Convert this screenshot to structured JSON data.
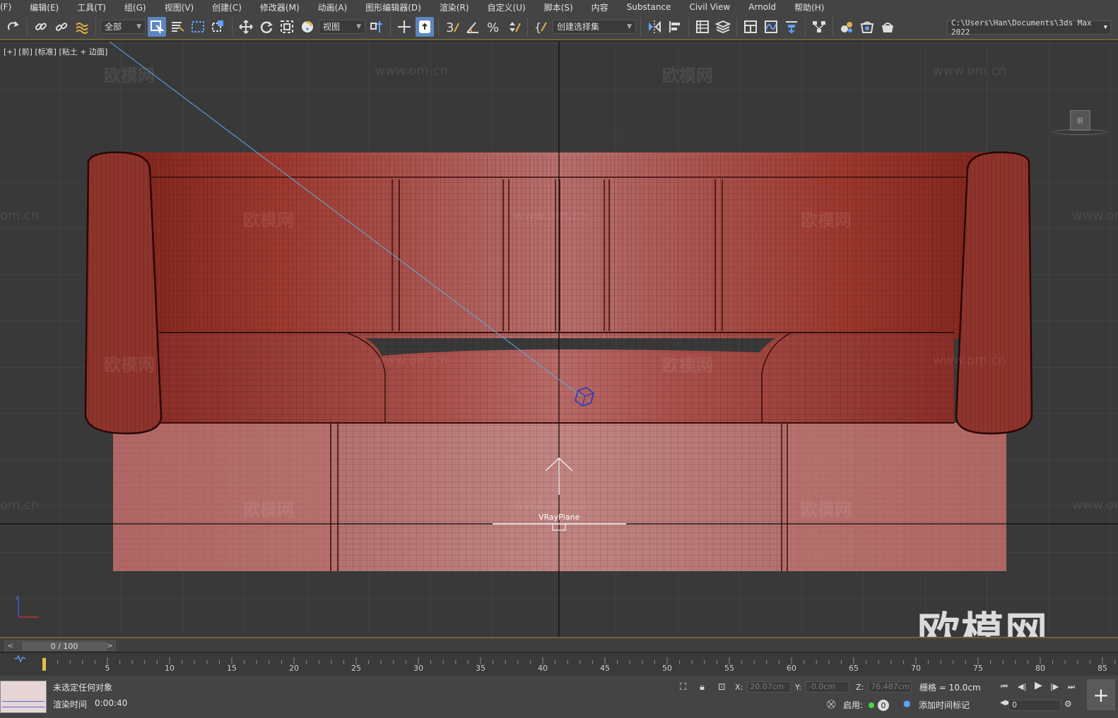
{
  "menu": {
    "items": [
      "(F)",
      "编辑(E)",
      "工具(T)",
      "组(G)",
      "视图(V)",
      "创建(C)",
      "修改器(M)",
      "动画(A)",
      "图形编辑器(D)",
      "渲染(R)",
      "自定义(U)",
      "脚本(S)",
      "内容",
      "Substance",
      "Civil View",
      "Arnold",
      "帮助(H)"
    ]
  },
  "toolbar": {
    "filter_value": "全部",
    "refcoord_value": "视图",
    "selection_set_placeholder": "创建选择集",
    "path": "C:\\Users\\Han\\Documents\\3ds Max 2022",
    "icons": [
      "redo-icon",
      "link-icon",
      "unlink-icon",
      "bind-space-warp-icon",
      "select-object-icon",
      "select-by-name-icon",
      "rect-region-icon",
      "window-crossing-icon",
      "move-icon",
      "rotate-icon",
      "scale-icon",
      "placement-icon",
      "ref-coord-icon",
      "pivot-icon",
      "xform-gizmo-icon",
      "keyboard-shortcut-icon",
      "snap-3d-icon",
      "angle-snap-icon",
      "percent-snap-icon",
      "spinner-snap-icon",
      "edit-named-sets-icon",
      "mirror-icon",
      "align-icon",
      "scene-explorer-icon",
      "layer-explorer-icon",
      "toggle-ribbon-icon",
      "curve-editor-icon",
      "dope-sheet-icon",
      "schematic-view-icon",
      "material-editor-icon",
      "render-setup-icon",
      "rendered-frame-icon",
      "render-icon"
    ]
  },
  "viewport": {
    "label": "[+] [前] [标准] [粘土 + 边面]",
    "object_label": "VRayPlane",
    "viewcube_label": "前",
    "watermark_brand": "欧模网",
    "watermark_url": "www.om.cn",
    "watermark_url_partial": "om.cn",
    "watermark_corner": "欧模网",
    "sofa_color": "#9b3b34",
    "grid_color": "#4a4a4a"
  },
  "timeline": {
    "frame_label": "0 / 100",
    "ticks": [
      "5",
      "10",
      "15",
      "20",
      "25",
      "30",
      "35",
      "40",
      "45",
      "50",
      "55",
      "60",
      "65",
      "70",
      "75",
      "80",
      "85"
    ]
  },
  "status": {
    "selection": "未选定任何对象",
    "render_time_label": "渲染时间",
    "render_time": "0:00:40",
    "x_label": "X:",
    "x_value": "20.07cm",
    "y_label": "Y:",
    "y_value": "-0.0cm",
    "z_label": "Z:",
    "z_value": "76.487cm",
    "grid": "栅格 = 10.0cm",
    "enable_label": "启用:",
    "key_count": "0",
    "add_time_tag": "添加时间标记",
    "current_frame": "0"
  }
}
